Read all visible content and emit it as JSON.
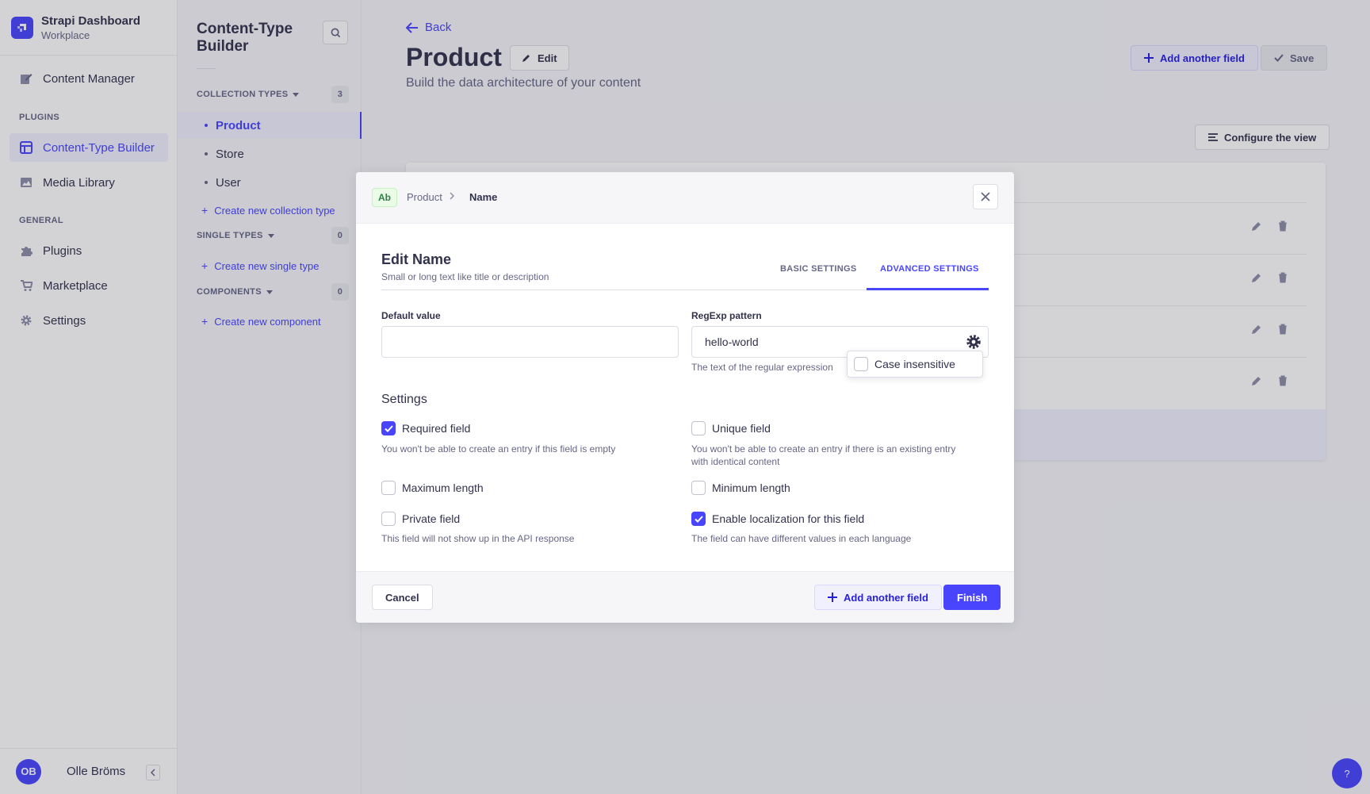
{
  "brand": {
    "title": "Strapi Dashboard",
    "subtitle": "Workplace"
  },
  "nav": {
    "content_manager": "Content Manager",
    "plugins_section": "PLUGINS",
    "content_type_builder": "Content-Type Builder",
    "media_library": "Media Library",
    "general_section": "GENERAL",
    "plugins": "Plugins",
    "marketplace": "Marketplace",
    "settings": "Settings"
  },
  "user": {
    "initials": "OB",
    "name": "Olle Bröms"
  },
  "ctb": {
    "title_line1": "Content-Type",
    "title_line2": "Builder",
    "collection_types": {
      "label": "COLLECTION TYPES",
      "count": "3",
      "items": [
        "Product",
        "Store",
        "User"
      ],
      "create": "Create new collection type"
    },
    "single_types": {
      "label": "SINGLE TYPES",
      "count": "0",
      "create": "Create new single type"
    },
    "components": {
      "label": "COMPONENTS",
      "count": "0",
      "create": "Create new component"
    }
  },
  "main": {
    "back": "Back",
    "title": "Product",
    "edit": "Edit",
    "subtitle": "Build the data architecture of your content",
    "add_field": "Add another field",
    "save": "Save",
    "configure_view": "Configure the view"
  },
  "modal": {
    "badge": "Ab",
    "breadcrumb": [
      "Product",
      "Name"
    ],
    "title": "Edit Name",
    "description": "Small or long text like title or description",
    "tabs": {
      "basic": "BASIC SETTINGS",
      "advanced": "ADVANCED SETTINGS"
    },
    "default_value": {
      "label": "Default value",
      "value": ""
    },
    "regexp": {
      "label": "RegExp pattern",
      "value": "hello-world",
      "hint": "The text of the regular expression"
    },
    "case_insensitive": {
      "label": "Case insensitive",
      "checked": false
    },
    "settings_title": "Settings",
    "options": {
      "required": {
        "label": "Required field",
        "hint": "You won't be able to create an entry if this field is empty",
        "checked": true
      },
      "unique": {
        "label": "Unique field",
        "hint_line1": "You won't be able to create an entry if there is an existing entry",
        "hint_line2": "with identical content",
        "checked": false
      },
      "max_length": {
        "label": "Maximum length",
        "checked": false
      },
      "min_length": {
        "label": "Minimum length",
        "checked": false
      },
      "private": {
        "label": "Private field",
        "hint": "This field will not show up in the API response",
        "checked": false
      },
      "localization": {
        "label": "Enable localization for this field",
        "hint": "The field can have different values in each language",
        "checked": true
      }
    },
    "cancel": "Cancel",
    "add_field": "Add another field",
    "finish": "Finish"
  },
  "help": "?",
  "colors": {
    "primary": "#4945ff",
    "primary_light": "#f0f0ff",
    "success_badge": "#eafbe7"
  }
}
